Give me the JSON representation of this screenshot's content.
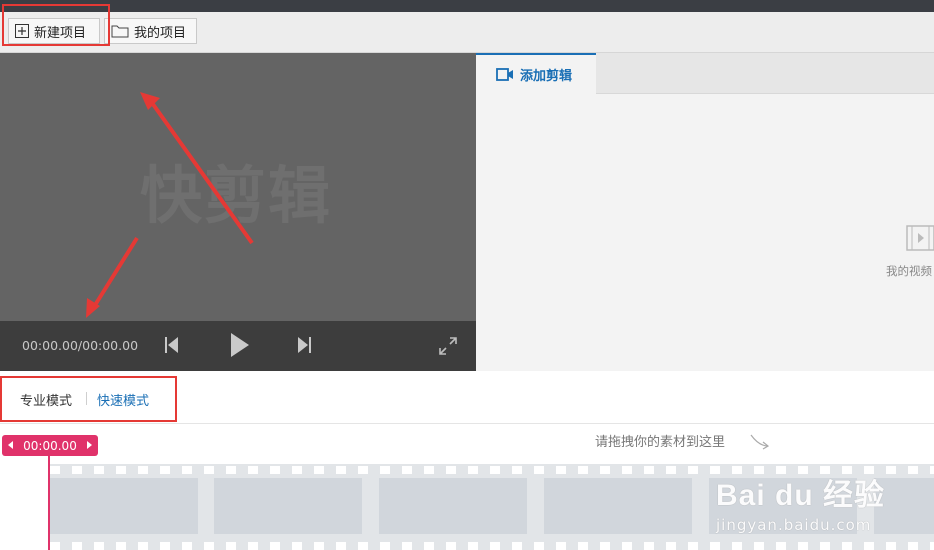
{
  "toolbar": {
    "new_project": "新建项目",
    "my_projects": "我的项目"
  },
  "preview": {
    "watermark": "快剪辑",
    "timecode": "00:00.00/00:00.00"
  },
  "side_panel": {
    "tab_label": "添加剪辑",
    "empty_text": "我的视频"
  },
  "modes": {
    "pro": "专业模式",
    "fast": "快速模式",
    "active": "fast"
  },
  "timeline": {
    "playhead_time": "00:00.00",
    "drop_hint": "请拖拽你的素材到这里"
  },
  "watermark_overlay": {
    "brand": "Bai du 经验",
    "url": "jingyan.baidu.com"
  },
  "colors": {
    "accent": "#1a6fb5",
    "playhead": "#e0326a",
    "annotation": "#e53935"
  },
  "icons": [
    "plus-square-icon",
    "folder-icon",
    "skip-back-icon",
    "play-icon",
    "skip-forward-icon",
    "fullscreen-icon",
    "video-camera-icon",
    "film-icon"
  ]
}
